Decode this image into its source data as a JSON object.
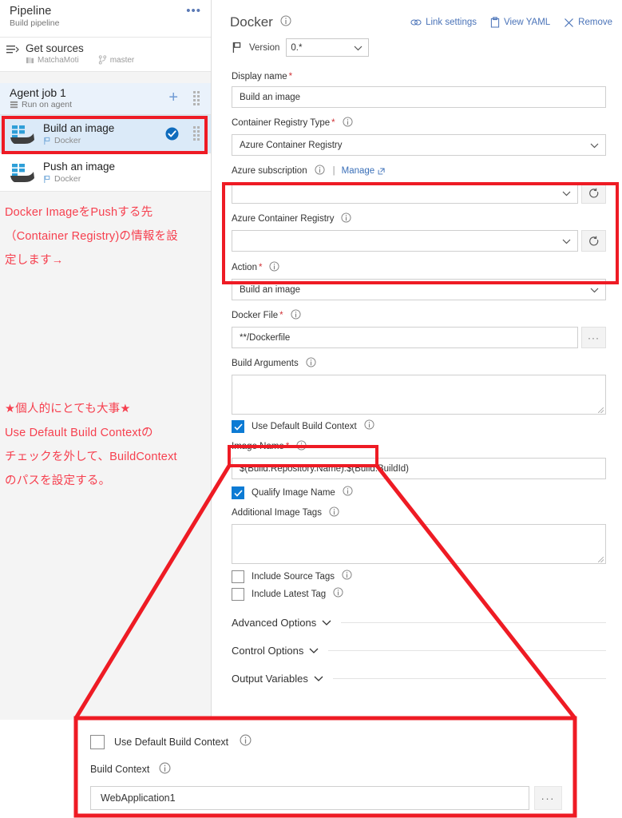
{
  "sidebar": {
    "title": "Pipeline",
    "subtitle": "Build pipeline",
    "more_label": "•••",
    "get_sources": {
      "title": "Get sources",
      "repo": "MatchaMoti",
      "branch": "master"
    },
    "agent_job": {
      "title": "Agent job 1",
      "subtitle": "Run on agent",
      "add_label": "+"
    },
    "tasks": [
      {
        "title": "Build an image",
        "subtitle": "Docker",
        "selected": true,
        "checked": true
      },
      {
        "title": "Push an image",
        "subtitle": "Docker",
        "selected": false,
        "checked": false
      }
    ],
    "annotations": [
      "Docker ImageをPushする先\n（Container Registry)の情報を設\n定します→",
      "★個人的にとても大事★\nUse Default Build Contextの\nチェックを外して、BuildContext\nのパスを設定する。"
    ]
  },
  "panel": {
    "title": "Docker",
    "actions": [
      {
        "label": "Link settings",
        "icon": "link-icon"
      },
      {
        "label": "View YAML",
        "icon": "clipboard-icon"
      },
      {
        "label": "Remove",
        "icon": "close-icon"
      }
    ],
    "version": {
      "label": "Version",
      "value": "0.*"
    },
    "fields": {
      "display_name": {
        "label": "Display name",
        "required": true,
        "value": "Build an image"
      },
      "container_registry_type": {
        "label": "Container Registry Type",
        "required": true,
        "value": "Azure Container Registry"
      },
      "azure_subscription": {
        "label": "Azure subscription",
        "required": false,
        "value": "",
        "manage_label": "Manage",
        "separator": "|"
      },
      "azure_container_registry": {
        "label": "Azure Container Registry",
        "required": false,
        "value": ""
      },
      "action": {
        "label": "Action",
        "required": true,
        "value": "Build an image"
      },
      "docker_file": {
        "label": "Docker File",
        "required": true,
        "value": "**/Dockerfile",
        "browse_label": "···"
      },
      "build_arguments": {
        "label": "Build Arguments",
        "required": false,
        "value": ""
      },
      "use_default_build_context": {
        "label": "Use Default Build Context",
        "checked": true
      },
      "image_name": {
        "label": "Image Name",
        "required": true,
        "value": "$(Build.Repository.Name):$(Build.BuildId)"
      },
      "qualify_image_name": {
        "label": "Qualify Image Name",
        "checked": true
      },
      "additional_image_tags": {
        "label": "Additional Image Tags",
        "required": false,
        "value": ""
      },
      "include_source_tags": {
        "label": "Include Source Tags",
        "checked": false
      },
      "include_latest_tag": {
        "label": "Include Latest Tag",
        "checked": false
      }
    },
    "sections": [
      {
        "label": "Advanced Options"
      },
      {
        "label": "Control Options"
      },
      {
        "label": "Output Variables"
      }
    ]
  },
  "callout": {
    "use_default_build_context": {
      "label": "Use Default Build Context",
      "checked": false
    },
    "build_context": {
      "label": "Build Context",
      "value": "WebApplication1",
      "browse_label": "···"
    }
  },
  "colors": {
    "annotation_red": "#f6404f",
    "highlight_red": "#ee1b24",
    "link_blue": "#4a73b8",
    "accent_blue": "#0d7bd4",
    "selected_row": "#dbeaf8",
    "agent_row": "#eaf2fb",
    "required_red": "#d13438"
  }
}
